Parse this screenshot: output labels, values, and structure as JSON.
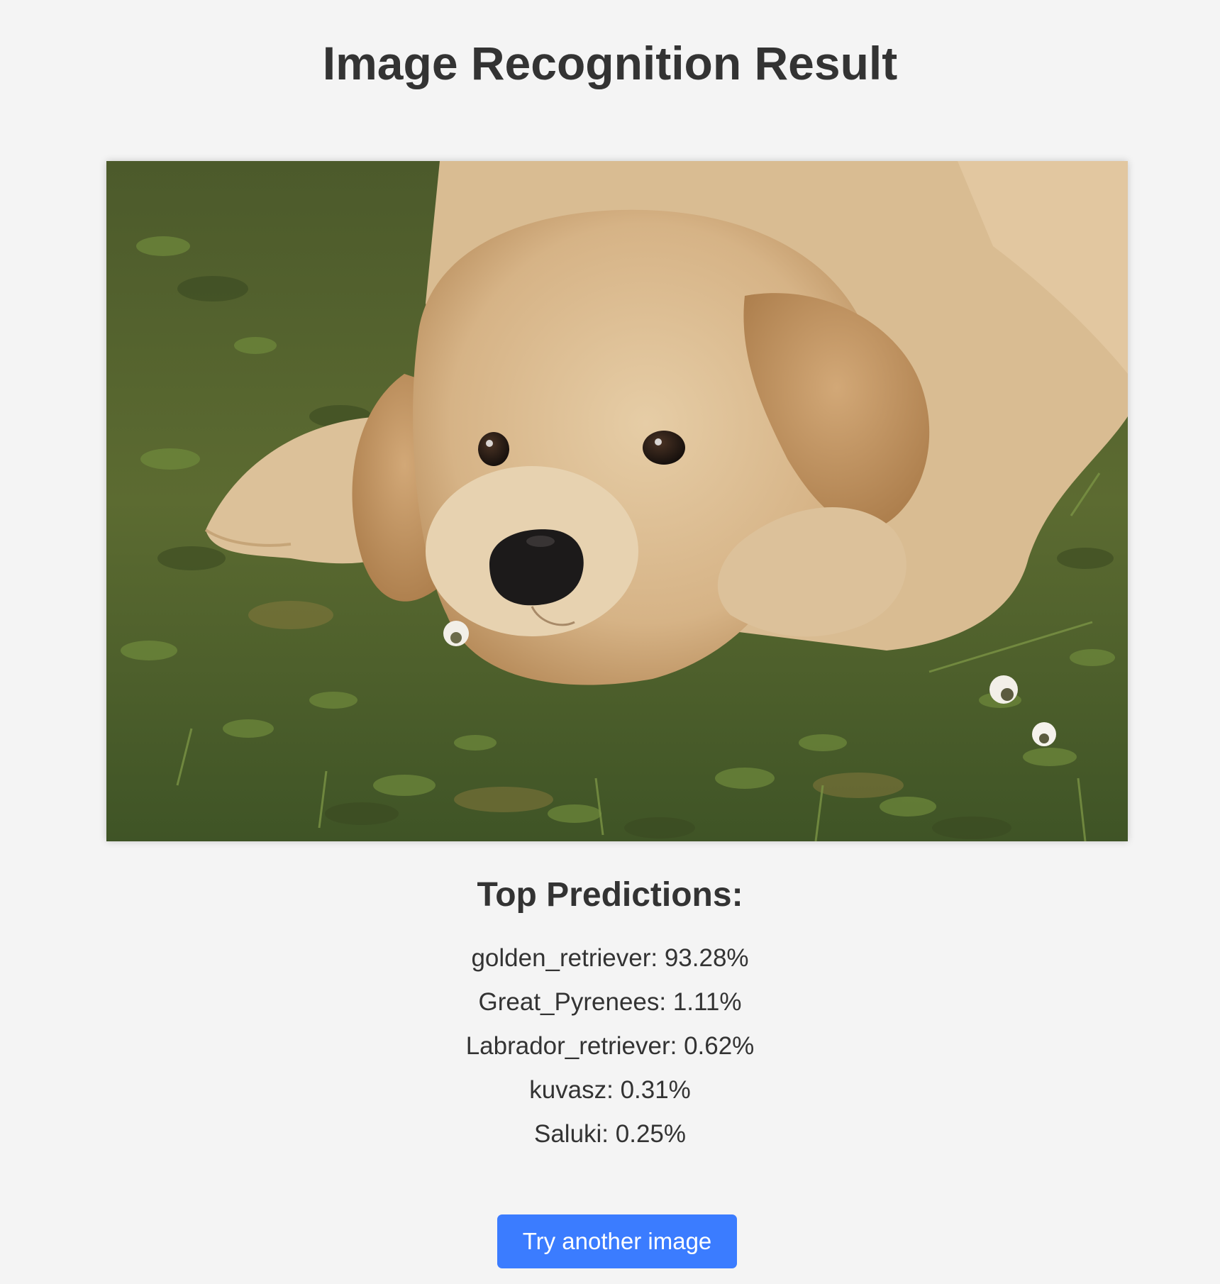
{
  "page": {
    "title": "Image Recognition Result"
  },
  "photo": {
    "subject": "golden retriever puppy lying on grass",
    "colors": {
      "grass": "#55632f",
      "fur": "#d8b88e",
      "nose": "#1c1a1a"
    }
  },
  "results": {
    "heading": "Top Predictions:",
    "predictions": [
      {
        "text": "golden_retriever: 93.28%",
        "label": "golden_retriever",
        "confidence": 93.28
      },
      {
        "text": "Great_Pyrenees: 1.11%",
        "label": "Great_Pyrenees",
        "confidence": 1.11
      },
      {
        "text": "Labrador_retriever: 0.62%",
        "label": "Labrador_retriever",
        "confidence": 0.62
      },
      {
        "text": "kuvasz: 0.31%",
        "label": "kuvasz",
        "confidence": 0.31
      },
      {
        "text": "Saluki: 0.25%",
        "label": "Saluki",
        "confidence": 0.25
      }
    ]
  },
  "actions": {
    "try_again_label": "Try another image",
    "button_color": "#3b7cff"
  }
}
